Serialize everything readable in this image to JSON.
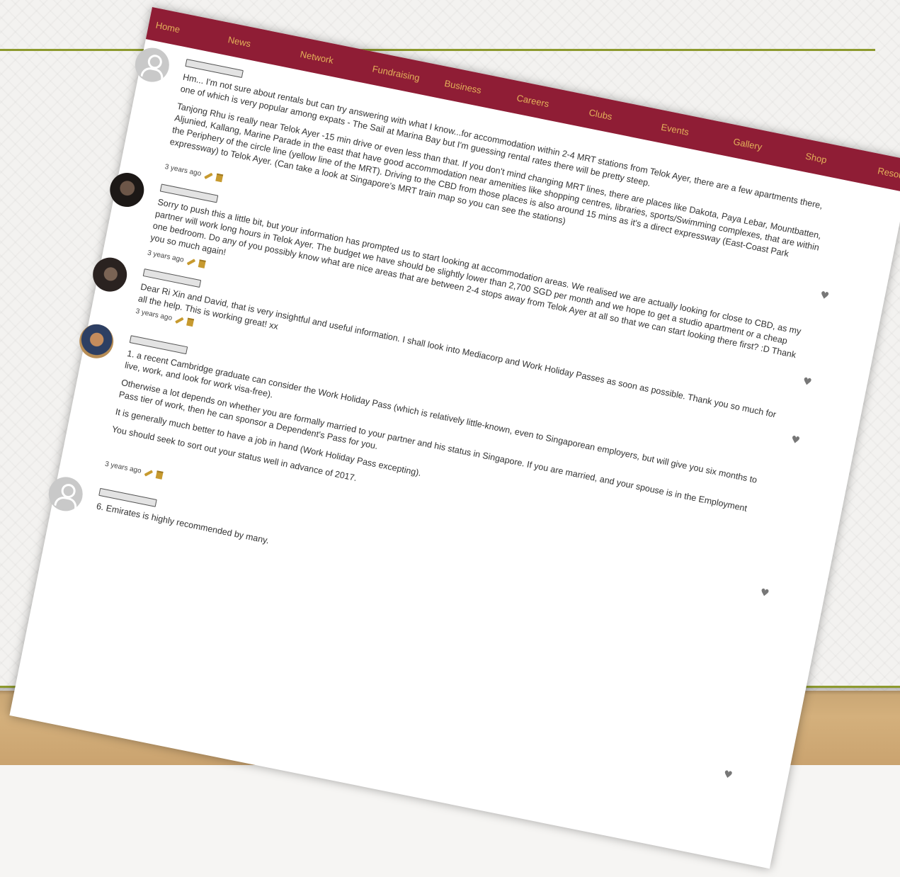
{
  "nav": [
    "Home",
    "News",
    "Network",
    "Fundraising",
    "Business",
    "Careers",
    "Clubs",
    "Events",
    "Gallery",
    "Shop",
    "Resources"
  ],
  "comments": [
    {
      "avatar": "default-avatar",
      "paragraphs": [
        "Hm... I'm not sure about rentals but can try answering with what I know...for accommodation within 2-4 MRT stations from Telok Ayer, there are a few apartments there, one of which is very popular among expats - The Sail at Marina Bay but I'm guessing rental rates there will be pretty steep.",
        "Tanjong Rhu is really near Telok Ayer -15 min drive or even less than that. If you don't mind changing MRT lines, there are places like Dakota, Paya Lebar, Mountbatten, Aljunied, Kallang, Marine Parade in the east that have good accommodation near amenities like shopping centres, libraries, sports/Swimming complexes, that are within the Periphery of the circle line (yellow line of the MRT). Driving to the CBD from those places is also around 15 mins as it's a direct expressway (East-Coast Park expressway) to Telok Ayer. (Can take a look at Singapore's MRT train map so you can see the stations)"
      ],
      "time": "3 years ago"
    },
    {
      "avatar": "photo-avatar",
      "paragraphs": [
        "Sorry to push this a little bit, but your information has prompted us to start looking at accommodation areas. We realised we are actually looking for close to CBD, as my partner will work long hours in Telok Ayer. The budget we have should be slightly lower than 2,700 SGD per month and we hope to get a studio apartment or a cheap one bedroom. Do any of you possibly know what are nice areas that are between 2-4 stops away from Telok Ayer at all so that we can start looking there first? :D Thank you so much again!"
      ],
      "time": "3 years ago"
    },
    {
      "avatar": "photo-avatar",
      "paragraphs": [
        "Dear Ri Xin and David, that is very insightful and useful information. I shall look into Mediacorp and Work Holiday Passes as soon as possible. Thank you so much for all the help. This is working great! xx"
      ],
      "time": "3 years ago"
    },
    {
      "avatar": "photo-avatar",
      "paragraphs": [
        "1. a recent Cambridge graduate can consider the Work Holiday Pass (which is relatively little-known, even to Singaporean employers, but will give you six months to live, work, and look for work visa-free).",
        "Otherwise a lot depends on whether you are formally married to your partner and his status in Singapore. If you are married, and your spouse is in the Employment Pass tier of work, then he can sponsor a Dependent's Pass for you.",
        "It is generally much better to have a job in hand (Work Holiday Pass excepting).",
        "You should seek to sort out your status well in advance of 2017."
      ],
      "time": "3 years ago"
    },
    {
      "avatar": "default-avatar",
      "paragraphs": [
        "6. Emirates is highly recommended by many."
      ],
      "time": ""
    }
  ],
  "icons": {
    "edit": "pencil-icon",
    "delete": "trash-icon",
    "like": "heart-icon"
  },
  "colors": {
    "nav_bg": "#8f1d35",
    "nav_text": "#e3b15a",
    "rule": "#8d9a2e",
    "icon_gold": "#c79a2f"
  }
}
